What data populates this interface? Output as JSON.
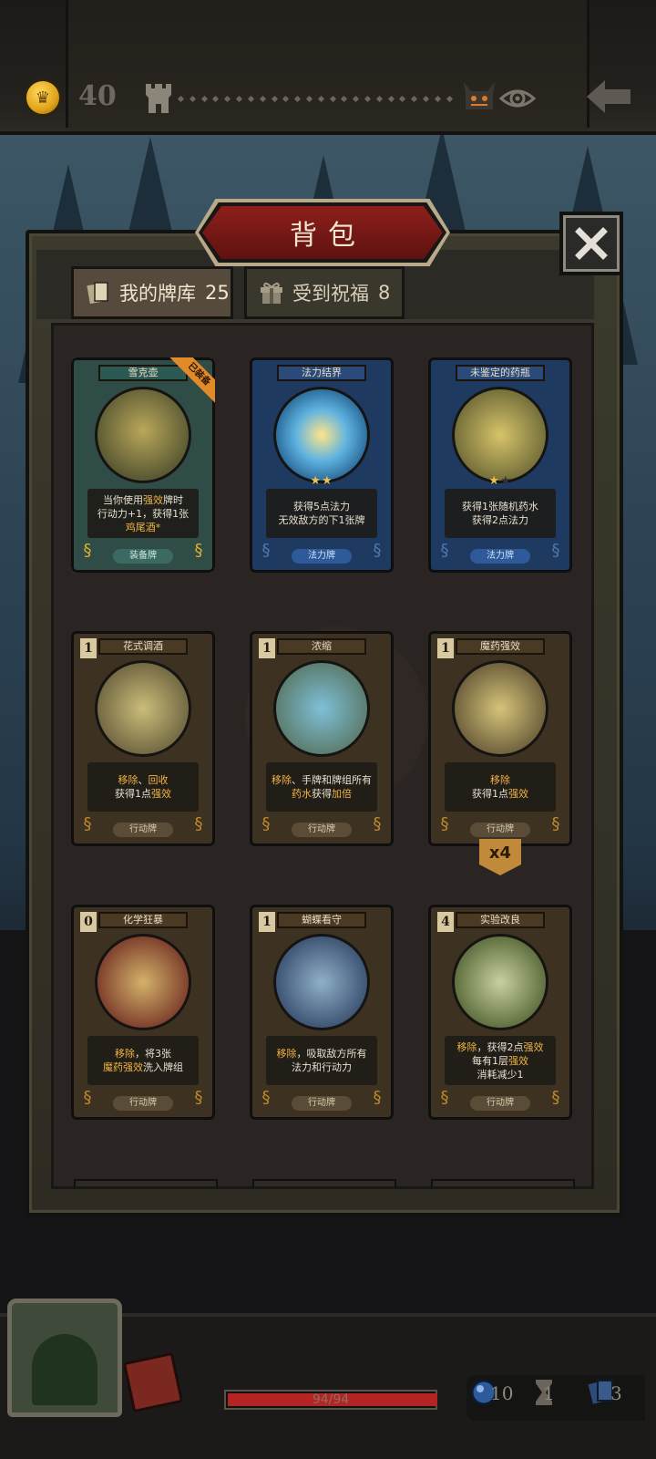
{
  "topbar": {
    "gold": "40",
    "icons": [
      "coin-icon",
      "castle-icon",
      "boss-icon",
      "eye-icon",
      "back-arrow-icon"
    ]
  },
  "bag": {
    "title": "背包",
    "tabs": [
      {
        "label": "我的牌库",
        "count": "25",
        "icon": "cards-icon",
        "active": true
      },
      {
        "label": "受到祝福",
        "count": "8",
        "icon": "gift-icon",
        "active": false
      }
    ]
  },
  "cards": [
    {
      "name": "雪克壶",
      "type": "装备牌",
      "kind": "equip",
      "equipped": "已装备",
      "desc": [
        [
          "当你使用",
          "强效",
          "牌时"
        ],
        [
          "行动力+1，获得1张"
        ],
        [
          "",
          "鸡尾酒*",
          ""
        ]
      ]
    },
    {
      "name": "法力结界",
      "type": "法力牌",
      "kind": "spell",
      "stars": 2,
      "max_stars": 2,
      "desc": [
        [
          "获得5点法力"
        ],
        [
          "无效敌方的下1张牌"
        ]
      ]
    },
    {
      "name": "未鉴定的药瓶",
      "type": "法力牌",
      "kind": "spell",
      "stars": 1,
      "max_stars": 2,
      "desc": [
        [
          "获得1张随机药水"
        ],
        [
          "获得2点法力"
        ]
      ]
    },
    {
      "name": "花式调酒",
      "type": "行动牌",
      "kind": "action",
      "cost": "1",
      "desc": [
        [
          "",
          "移除",
          "、",
          "回收",
          ""
        ],
        [
          "获得1点",
          "强效",
          ""
        ]
      ]
    },
    {
      "name": "浓缩",
      "type": "行动牌",
      "kind": "action",
      "cost": "1",
      "desc": [
        [
          "",
          "移除",
          "、手牌和牌组所有"
        ],
        [
          "",
          "药水",
          "获得",
          "加倍",
          ""
        ]
      ]
    },
    {
      "name": "魔药强效",
      "type": "行动牌",
      "kind": "action",
      "cost": "1",
      "count": "x4",
      "desc": [
        [
          "",
          "移除",
          ""
        ],
        [
          "获得1点",
          "强效",
          ""
        ]
      ]
    },
    {
      "name": "化学狂暴",
      "type": "行动牌",
      "kind": "action",
      "cost": "0",
      "desc": [
        [
          "",
          "移除",
          "，将3张"
        ],
        [
          "",
          "魔药强效",
          "洗入牌组"
        ]
      ]
    },
    {
      "name": "蝴蝶看守",
      "type": "行动牌",
      "kind": "action",
      "cost": "1",
      "desc": [
        [
          "",
          "移除",
          "，吸取敌方所有"
        ],
        [
          "法力和行动力"
        ]
      ]
    },
    {
      "name": "实验改良",
      "type": "行动牌",
      "kind": "action",
      "cost": "4",
      "desc": [
        [
          "",
          "移除",
          "，获得2点",
          "强效",
          ""
        ],
        [
          "每有1层",
          "强效",
          ""
        ],
        [
          "消耗减少1"
        ]
      ]
    }
  ],
  "bottombar": {
    "hp": "94/94",
    "hp_fraction": 1.0,
    "resources": [
      {
        "name": "mana-orb-icon",
        "value": "10"
      },
      {
        "name": "hourglass-icon",
        "value": "1"
      },
      {
        "name": "cards-icon",
        "value": "3"
      }
    ]
  }
}
